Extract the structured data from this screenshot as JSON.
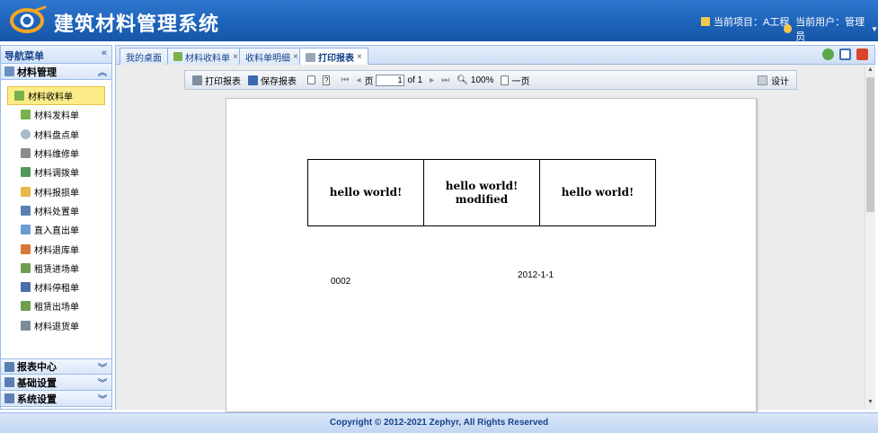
{
  "header": {
    "app_title": "建筑材料管理系统",
    "current_project": "当前项目：A工程",
    "current_user": "当前用户：管理员",
    "colors": {
      "bg": "#1e63b9",
      "logo_accent": "#f5a623"
    }
  },
  "sidebar": {
    "title": "导航菜单",
    "group_material": "材料管理",
    "items": [
      {
        "label": "材料收料单",
        "icon": "house-icon"
      },
      {
        "label": "材料发料单",
        "icon": "house-icon"
      },
      {
        "label": "材料盘点单",
        "icon": "magnifier-icon"
      },
      {
        "label": "材料维修单",
        "icon": "tools-icon"
      },
      {
        "label": "材料调拨单",
        "icon": "transfer-icon"
      },
      {
        "label": "材料报损单",
        "icon": "folder-icon"
      },
      {
        "label": "材料处置单",
        "icon": "list-icon"
      },
      {
        "label": "直入直出单",
        "icon": "document-icon"
      },
      {
        "label": "材料退库单",
        "icon": "return-icon"
      },
      {
        "label": "租赁进场单",
        "icon": "lease-icon"
      },
      {
        "label": "材料停租单",
        "icon": "pause-icon"
      },
      {
        "label": "租赁出场单",
        "icon": "lease-icon"
      },
      {
        "label": "材料退货单",
        "icon": "truck-icon"
      }
    ],
    "group_reports": "报表中心",
    "group_basic": "基础设置",
    "group_system": "系统设置"
  },
  "tabs": [
    {
      "label": "我的桌面",
      "closable": false
    },
    {
      "label": "材料收料单",
      "closable": true
    },
    {
      "label": "收料单明细",
      "closable": true
    },
    {
      "label": "打印报表",
      "closable": true
    }
  ],
  "report_toolbar": {
    "print": "打印报表",
    "save": "保存报表",
    "page_label": "页",
    "page_value": "1",
    "of_pages": "of 1",
    "zoom": "100%",
    "one_page": "一页",
    "design": "设计"
  },
  "report": {
    "cells": [
      "hello world!",
      "hello world!\nmodified",
      "hello world!"
    ],
    "code": "0002",
    "date": "2012-1-1"
  },
  "footer": {
    "copyright": "Copyright © 2012-2021 Zephyr, All Rights Reserved"
  }
}
